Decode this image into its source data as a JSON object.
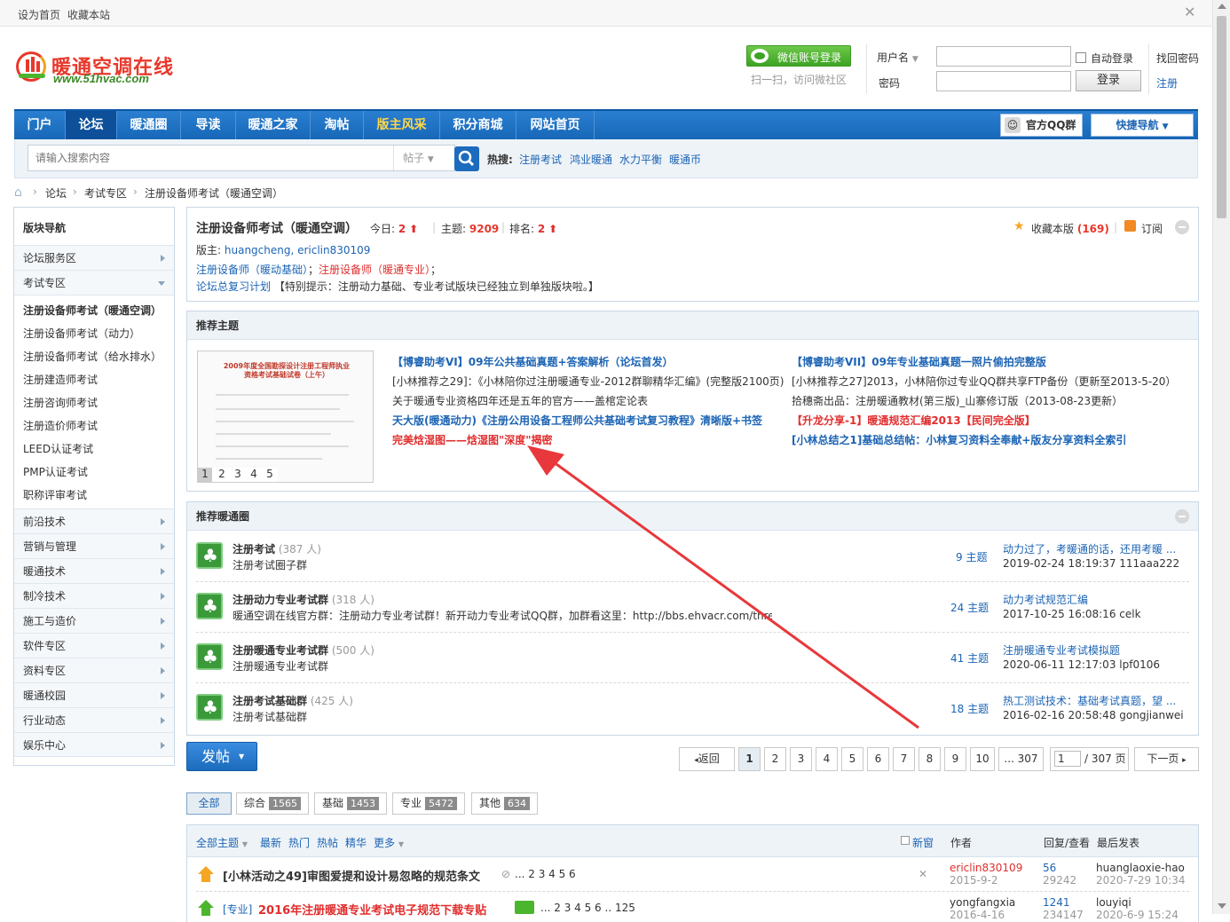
{
  "topbar": {
    "set_home": "设为首页",
    "bookmark": "收藏本站"
  },
  "header": {
    "logo_cn": "暖通空调在线",
    "logo_en": "www.51hvac.com",
    "wechat_login": "微信账号登录",
    "wechat_hint": "扫一扫，访问微社区",
    "username_label": "用户名",
    "password_label": "密码",
    "auto_login": "自动登录",
    "login_btn": "登录",
    "find_password": "找回密码",
    "register": "注册"
  },
  "nav": {
    "items": [
      "门户",
      "论坛",
      "暖通圈",
      "导读",
      "暖通之家",
      "淘帖",
      "版主风采",
      "积分商城",
      "网站首页"
    ],
    "qq_group": "官方QQ群",
    "quick_nav": "快捷导航"
  },
  "search": {
    "placeholder": "请输入搜索内容",
    "type": "帖子",
    "hot_label": "热搜:",
    "hot": [
      "注册考试",
      "鸿业暖通",
      "水力平衡",
      "暖通币"
    ]
  },
  "breadcrumb": [
    "论坛",
    "考试专区",
    "注册设备师考试（暖通空调）"
  ],
  "sidebar": {
    "title": "版块导航",
    "sections": [
      "论坛服务区",
      "考试专区"
    ],
    "exam_items": [
      "注册设备师考试（暖通空调）",
      "注册设备师考试（动力）",
      "注册设备师考试（给水排水）",
      "注册建造师考试",
      "注册咨询师考试",
      "注册造价师考试",
      "LEED认证考试",
      "PMP认证考试",
      "职称评审考试"
    ],
    "more_sections": [
      "前沿技术",
      "营销与管理",
      "暖通技术",
      "制冷技术",
      "施工与造价",
      "软件专区",
      "资料专区",
      "暖通校园",
      "行业动态",
      "娱乐中心"
    ]
  },
  "forum": {
    "title": "注册设备师考试（暖通空调）",
    "today_label": "今日:",
    "today": "2",
    "topics_label": "主题:",
    "topics": "9209",
    "rank_label": "排名:",
    "rank": "2",
    "favorite": "收藏本版",
    "favorite_count": "(169)",
    "subscribe": "订阅",
    "moderators_label": "版主:",
    "moderators": "huangcheng, ericlin830109",
    "link1": "注册设备师（暖动基础）",
    "link2": "注册设备师（暖通专业）",
    "link3": "论坛总复习计划",
    "notice": "【特别提示：注册动力基础、专业考试版块已经独立到单独版块啦。】"
  },
  "recommended": {
    "title": "推荐主题",
    "image_title": "2009年度全国勘探设计注册工程师执业资格考试基础试卷（上午）",
    "image_pages": [
      "1",
      "2",
      "3",
      "4",
      "5"
    ],
    "left": [
      "【博睿助考VI】09年公共基础真题+答案解析（论坛首发）",
      "[小林推荐之29]：《小林陪你过注册暖通专业-2012群聊精华汇编》(完整版2100页)",
      "关于暖通专业资格四年还是五年的官方——盖棺定论表",
      "天大版(暖通动力)《注册公用设备工程师公共基础考试复习教程》清晰版+书签",
      "完美焓湿图——焓湿图\"深度\"揭密"
    ],
    "right": [
      "【博睿助考VII】09年专业基础真题一照片偷拍完整版",
      "[小林推荐之27]2013，小林陪你过专业QQ群共享FTP备份（更新至2013-5-20）",
      "拾穗斋出品：注册暖通教材(第三版)_山寨修订版（2013-08-23更新）",
      "【升龙分享-1】暖通规范汇编2013【民间完全版】",
      "[小林总结之1]基础总结帖：小林复习资料全奉献+版友分享资料全索引"
    ]
  },
  "groups": {
    "title": "推荐暖通圈",
    "items": [
      {
        "name": "注册考试",
        "members": "(387 人)",
        "desc": "注册考试圈子群",
        "topics": "9 主题",
        "last_title": "动力过了，考暖通的话，还用考暖 ...",
        "last_info": "2019-02-24 18:19:37 111aaa222"
      },
      {
        "name": "注册动力专业考试群",
        "members": "(318 人)",
        "desc": "暖通空调在线官方群：注册动力专业考试群！新开动力专业考试QQ群，加群看这里：http://bbs.ehvacr.com/thre...",
        "topics": "24 主题",
        "last_title": "动力考试规范汇编",
        "last_info": "2017-10-25 16:08:16 celk"
      },
      {
        "name": "注册暖通专业考试群",
        "members": "(500 人)",
        "desc": "注册暖通专业考试群",
        "topics": "41 主题",
        "last_title": "注册暖通专业考试模拟题",
        "last_info": "2020-06-11 12:17:03 lpf0106"
      },
      {
        "name": "注册考试基础群",
        "members": "(425 人)",
        "desc": "注册考试基础群",
        "topics": "18 主题",
        "last_title": "热工测试技术：基础考试真题，望 ...",
        "last_info": "2016-02-16 20:58:48 gongjianwei"
      }
    ]
  },
  "post_btn": "发帖",
  "pagination": {
    "prev": "返回",
    "pages": [
      "1",
      "2",
      "3",
      "4",
      "5",
      "6",
      "7",
      "8",
      "9",
      "10",
      "... 307"
    ],
    "current_input": "1",
    "total": "/ 307 页",
    "next": "下一页"
  },
  "tabs": [
    {
      "label": "全部",
      "count": ""
    },
    {
      "label": "综合",
      "count": "1565"
    },
    {
      "label": "基础",
      "count": "1453"
    },
    {
      "label": "专业",
      "count": "5472"
    },
    {
      "label": "其他",
      "count": "634"
    }
  ],
  "thread_header": {
    "filter_all": "全部主题",
    "filters": [
      "最新",
      "热门",
      "热帖",
      "精华",
      "更多"
    ],
    "new_window": "新窗",
    "author": "作者",
    "reply_view": "回复/查看",
    "last_post": "最后发表"
  },
  "threads": [
    {
      "prefix": "",
      "title": "[小林活动之49]审图爱提和设计易忽略的规范条文",
      "pages": "... 2 3 4 5 6",
      "author": "ericlin830109",
      "date": "2015-9-2",
      "replies": "56",
      "views": "29242",
      "last_user": "huanglaoxie-hao",
      "last_date": "2020-7-29 10:34"
    },
    {
      "prefix": "[专业]",
      "title": "2016年注册暖通专业考试电子规范下载专贴",
      "pages": "... 2 3 4 5 6 .. 125",
      "author": "yongfangxia",
      "date": "2016-4-16",
      "replies": "1241",
      "views": "234147",
      "last_user": "louyiqi",
      "last_date": "2020-6-9 15:24"
    }
  ],
  "colors": {
    "nav_blue": "#1c6bbd",
    "link_blue": "#1c64b4",
    "red": "#e12e2e",
    "green": "#4cb52e"
  }
}
